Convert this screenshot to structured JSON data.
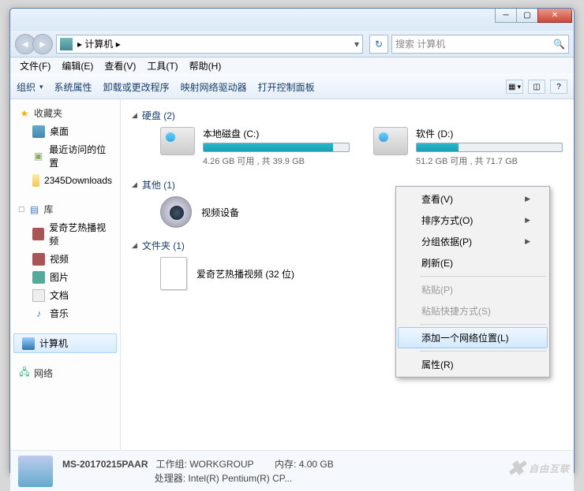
{
  "title_bar": {
    "min": "─",
    "max": "▢",
    "close": "✕"
  },
  "nav": {
    "back": "◄",
    "fwd": "►",
    "breadcrumb": "计算机",
    "breadcrumb_sep": "▸",
    "dropdown": "▾",
    "refresh": "↻",
    "search_placeholder": "搜索 计算机",
    "search_icon": "🔍"
  },
  "menu": [
    "文件(F)",
    "编辑(E)",
    "查看(V)",
    "工具(T)",
    "帮助(H)"
  ],
  "toolbar": {
    "organize": "组织",
    "properties": "系统属性",
    "uninstall": "卸载或更改程序",
    "map_drive": "映射网络驱动器",
    "control_panel": "打开控制面板",
    "view_icon": "▦",
    "layout_icon": "◫",
    "help_icon": "?"
  },
  "sidebar": {
    "favorites": {
      "label": "收藏夹",
      "items": [
        "桌面",
        "最近访问的位置",
        "2345Downloads"
      ]
    },
    "libraries": {
      "label": "库",
      "items": [
        "爱奇艺热播视频",
        "视频",
        "图片",
        "文档",
        "音乐"
      ]
    },
    "computer": "计算机",
    "network": "网络"
  },
  "content": {
    "drives_header": "硬盘 (2)",
    "drives": [
      {
        "name": "本地磁盘 (C:)",
        "free": "4.26 GB 可用 , 共 39.9 GB",
        "fill_pct": 89
      },
      {
        "name": "软件 (D:)",
        "free": "51.2 GB 可用 , 共 71.7 GB",
        "fill_pct": 29
      }
    ],
    "other_header": "其他 (1)",
    "other_item": "视频设备",
    "folder_header": "文件夹 (1)",
    "folder_item": "爱奇艺热播视频 (32 位)"
  },
  "context_menu": {
    "items": [
      {
        "label": "查看(V)",
        "sub": true
      },
      {
        "label": "排序方式(O)",
        "sub": true
      },
      {
        "label": "分组依据(P)",
        "sub": true
      },
      {
        "label": "刷新(E)"
      },
      {
        "sep": true
      },
      {
        "label": "粘贴(P)",
        "disabled": true
      },
      {
        "label": "粘贴快捷方式(S)",
        "disabled": true
      },
      {
        "sep": true
      },
      {
        "label": "添加一个网络位置(L)",
        "highlight": true
      },
      {
        "sep": true
      },
      {
        "label": "属性(R)"
      }
    ]
  },
  "status": {
    "name": "MS-20170215PAAR",
    "workgroup_label": "工作组:",
    "workgroup": "WORKGROUP",
    "mem_label": "内存:",
    "mem": "4.00 GB",
    "cpu_label": "处理器:",
    "cpu": "Intel(R) Pentium(R) CP..."
  },
  "watermark": "自由互联"
}
